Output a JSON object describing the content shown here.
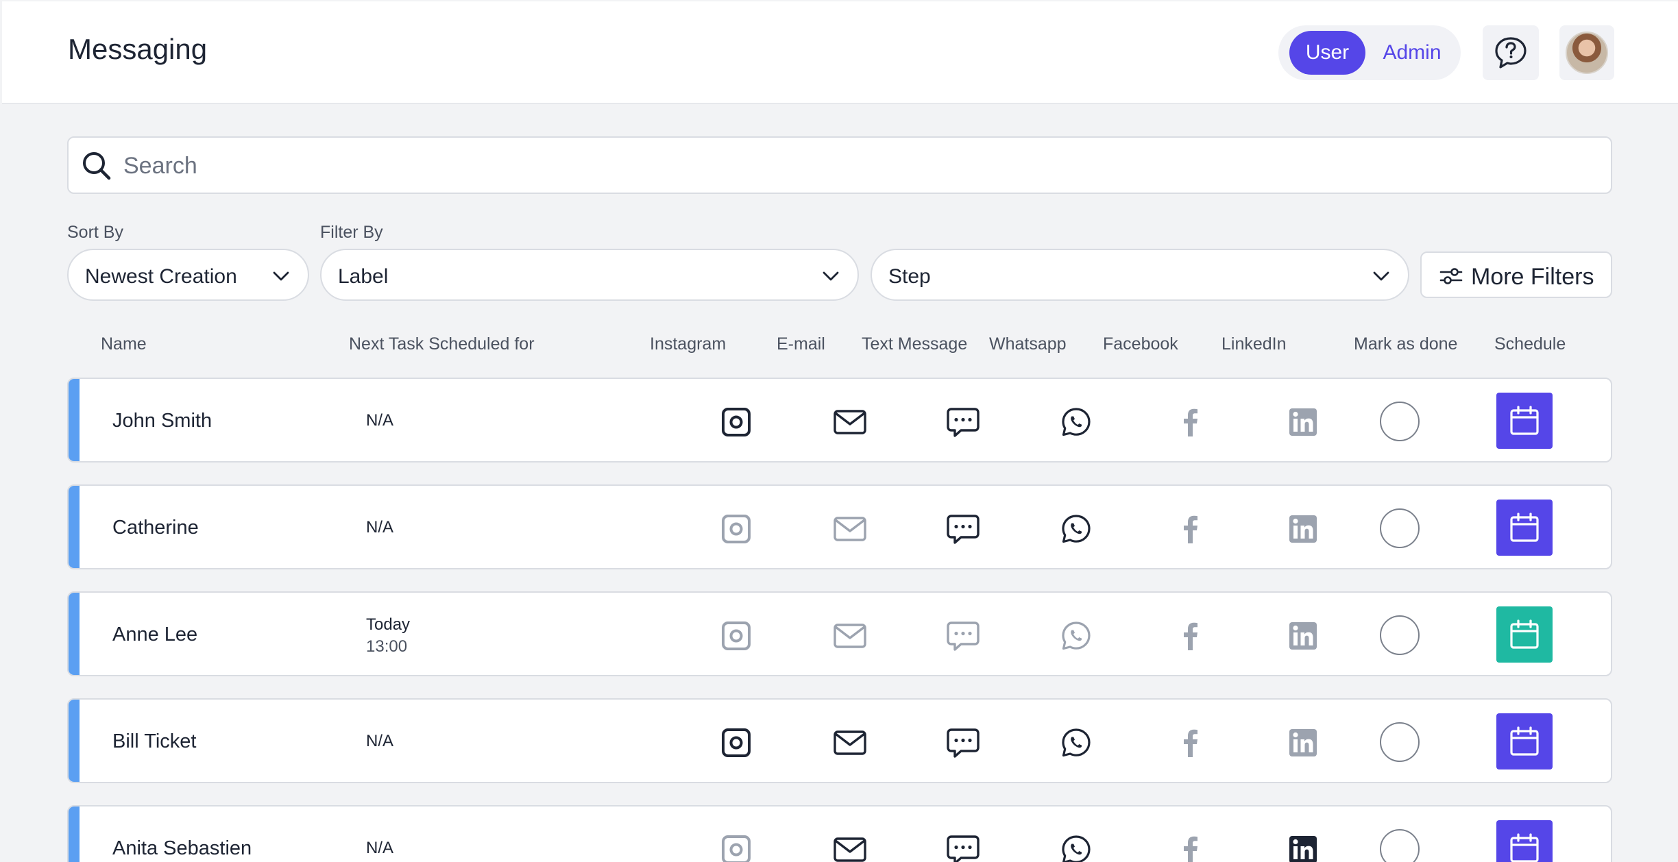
{
  "header": {
    "title": "Messaging",
    "role_user": "User",
    "role_admin": "Admin"
  },
  "search": {
    "placeholder": "Search",
    "value": ""
  },
  "filters": {
    "sort_label": "Sort By",
    "sort_value": "Newest Creation",
    "filter_label": "Filter By",
    "label_value": "Label",
    "step_value": "Step",
    "more_filters": "More Filters"
  },
  "columns": [
    "Name",
    "Next Task Scheduled for",
    "Instagram",
    "E-mail",
    "Text Message",
    "Whatsapp",
    "Facebook",
    "LinkedIn",
    "Mark as done",
    "Schedule"
  ],
  "colors": {
    "accent": "#5546e8",
    "row_accent": "#5b9ff2",
    "active_icon": "#1d2433",
    "inactive_icon": "#9ca3af",
    "schedule_today": "#1fb9a2",
    "linkedin_active": "#1d2433",
    "linkedin_inactive": "#9ca3af"
  },
  "rows": [
    {
      "name": "John Smith",
      "next_task": "N/A",
      "next_task_time": "",
      "channels": {
        "instagram": true,
        "email": true,
        "text": true,
        "whatsapp": true,
        "facebook": false,
        "linkedin": false
      },
      "done": false,
      "schedule_color": "purple"
    },
    {
      "name": "Catherine",
      "next_task": "N/A",
      "next_task_time": "",
      "channels": {
        "instagram": false,
        "email": false,
        "text": true,
        "whatsapp": true,
        "facebook": false,
        "linkedin": false
      },
      "done": false,
      "schedule_color": "purple"
    },
    {
      "name": "Anne Lee",
      "next_task": "Today",
      "next_task_time": "13:00",
      "channels": {
        "instagram": false,
        "email": false,
        "text": false,
        "whatsapp": false,
        "facebook": false,
        "linkedin": false
      },
      "done": false,
      "schedule_color": "teal"
    },
    {
      "name": "Bill Ticket",
      "next_task": "N/A",
      "next_task_time": "",
      "channels": {
        "instagram": true,
        "email": true,
        "text": true,
        "whatsapp": true,
        "facebook": false,
        "linkedin": false
      },
      "done": false,
      "schedule_color": "purple"
    },
    {
      "name": "Anita Sebastien",
      "next_task": "N/A",
      "next_task_time": "",
      "channels": {
        "instagram": false,
        "email": true,
        "text": true,
        "whatsapp": true,
        "facebook": false,
        "linkedin": true
      },
      "done": false,
      "schedule_color": "purple"
    }
  ]
}
